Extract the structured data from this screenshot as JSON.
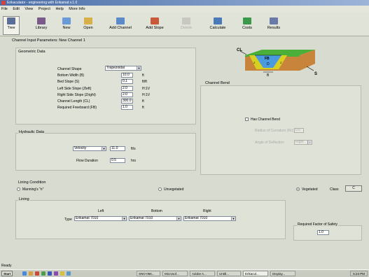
{
  "window": {
    "title": "Erikaculator - engineering with Erikamat v.1.0"
  },
  "menu": [
    "File",
    "Edit",
    "View",
    "Project",
    "Help",
    "More Info"
  ],
  "toolbar": {
    "buttons": [
      {
        "label": "Tree",
        "icon": "tree-icon"
      },
      {
        "label": "Library",
        "icon": "library-icon"
      },
      {
        "label": "New",
        "icon": "new-icon"
      },
      {
        "label": "Open",
        "icon": "open-icon"
      },
      {
        "label": "Add Channel",
        "icon": "add-channel-icon"
      },
      {
        "label": "Add Slope",
        "icon": "add-slope-icon"
      },
      {
        "label": "Delete",
        "icon": "delete-icon"
      },
      {
        "label": "Calculate",
        "icon": "calculate-icon"
      },
      {
        "label": "Costs",
        "icon": "costs-icon"
      },
      {
        "label": "Results",
        "icon": "results-icon"
      }
    ]
  },
  "form": {
    "header": "Channel Input Parameters: New Channel 1"
  },
  "geometric": {
    "title": "Geometric Data",
    "fields": [
      {
        "label": "Channel Shape",
        "value": "Trapezoidal",
        "unit": ""
      },
      {
        "label": "Bottom Width (B)",
        "value": "10.0",
        "unit": "ft"
      },
      {
        "label": "Bed Slope (S)",
        "value": "0.1",
        "unit": "ft/ft"
      },
      {
        "label": "Left Side Slope (Zleft)",
        "value": "2.0",
        "unit": "H:1V"
      },
      {
        "label": "Right Side Slope (Zright)",
        "value": "2.0",
        "unit": "H:1V"
      },
      {
        "label": "Channel Length (CL)",
        "value": "300.0",
        "unit": "ft"
      },
      {
        "label": "Required Freeboard (FB)",
        "value": "1.0",
        "unit": "ft"
      }
    ]
  },
  "diagram": {
    "cl": "CL",
    "fb": "FB",
    "d": "D",
    "b": "B",
    "s": "S",
    "z1": "Z",
    "z2": "Z"
  },
  "bend": {
    "title": "Channel Bend",
    "checkbox_label": "Has Channel Bend",
    "radius_label": "Radius of Curvature (Rc)",
    "radius_value": "0.0",
    "angle_label": "Angle of Deflection",
    "angle_value": "Right"
  },
  "hydraulic": {
    "title": "Hydraulic Data",
    "mode": "Velocity",
    "value": "11.0",
    "unit": "ft/s",
    "duration_label": "Flow Duration",
    "duration_value": "0.5",
    "duration_unit": "hrs"
  },
  "lining_condition": {
    "title": "Lining Condition",
    "options": [
      "Manning's \"n\"",
      "Unvegetated",
      "Vegetated"
    ],
    "selected": "Vegetated",
    "class_label": "Class",
    "class_value": "C"
  },
  "lining": {
    "title": "Lining",
    "headers": [
      "Left",
      "Bottom",
      "Right"
    ],
    "type_label": "Type",
    "values": [
      "Erikamat 7010",
      "Erikamat 7010",
      "Erikamat 7010"
    ],
    "fs_label": "Required Factor of Safety",
    "fs_value": "1.0"
  },
  "status": {
    "text": "Ready"
  },
  "taskbar": {
    "start": "Start",
    "tasks": [
      "SNO-056...",
      "Microsof...",
      "Adobe A...",
      "Untitl...",
      "Erikacul...",
      "Display..."
    ],
    "clock": "5:24 PM"
  },
  "colors": {
    "grass": "#4caf3a",
    "soil": "#c8843a",
    "water": "#4a9ae0",
    "lining": "#d8d020"
  }
}
